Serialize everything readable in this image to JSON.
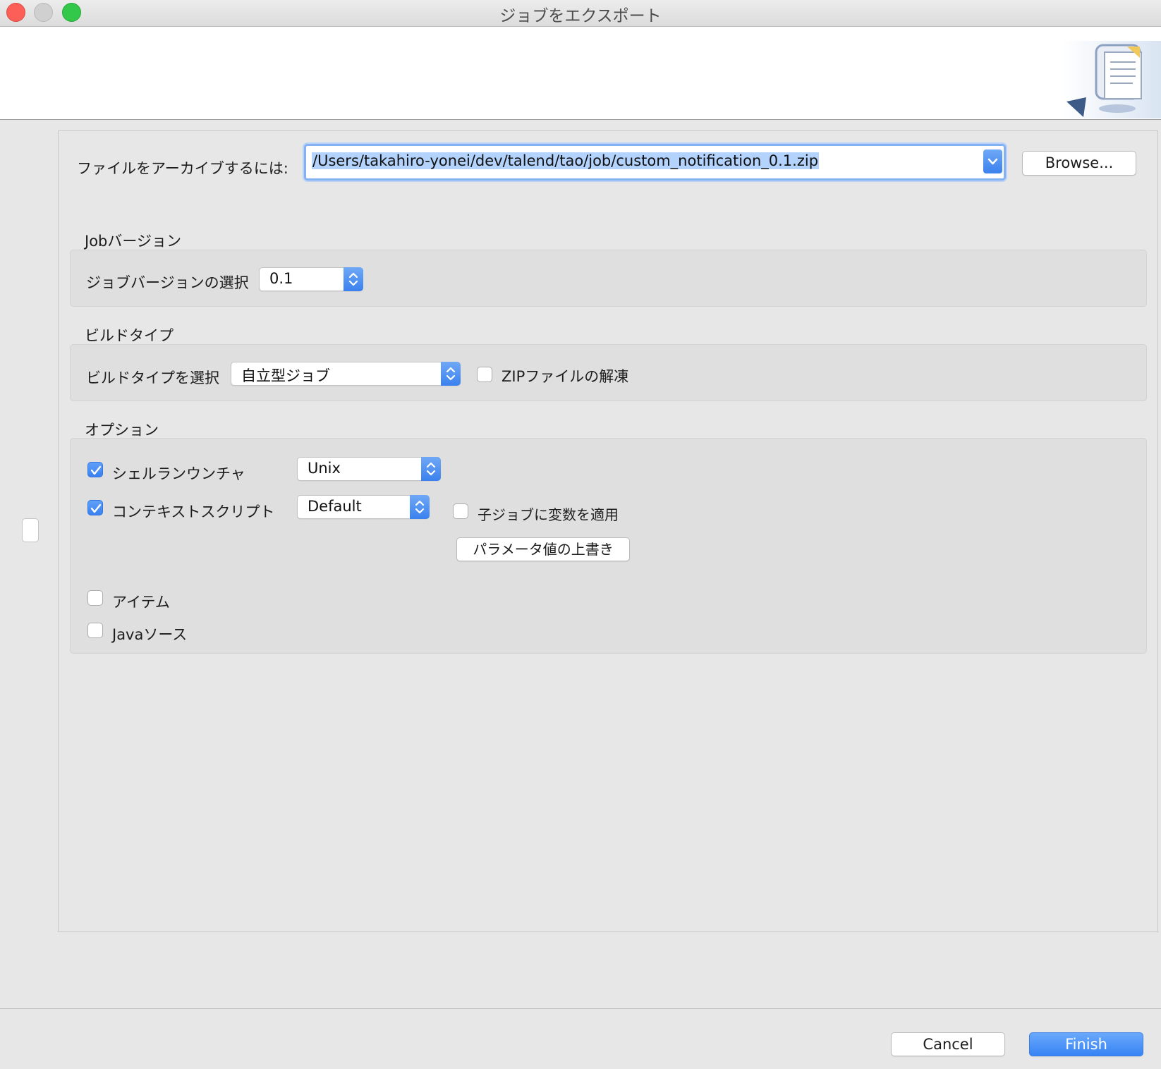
{
  "window": {
    "title": "ジョブをエクスポート"
  },
  "archive": {
    "label": "ファイルをアーカイブするには:",
    "path": "/Users/takahiro-yonei/dev/talend/tao/job/custom_notification_0.1.zip",
    "browse_label": "Browse..."
  },
  "job_version": {
    "group_title": "Jobバージョン",
    "label": "ジョブバージョンの選択",
    "selected": "0.1"
  },
  "build_type": {
    "group_title": "ビルドタイプ",
    "label": "ビルドタイプを選択",
    "selected": "自立型ジョブ",
    "unzip_label": "ZIPファイルの解凍",
    "unzip_checked": false
  },
  "options": {
    "group_title": "オプション",
    "shell_launcher": {
      "label": "シェルランウンチャ",
      "checked": true,
      "selected": "Unix"
    },
    "context_script": {
      "label": "コンテキストスクリプト",
      "checked": true,
      "selected": "Default"
    },
    "apply_child_label": "子ジョブに変数を適用",
    "apply_child_checked": false,
    "override_params_label": "パラメータ値の上書き",
    "items": {
      "label": "アイテム",
      "checked": false
    },
    "java_source": {
      "label": "Javaソース",
      "checked": false
    }
  },
  "footer": {
    "cancel_label": "Cancel",
    "finish_label": "Finish"
  },
  "colors": {
    "accent": "#3b81ee",
    "selection": "#b4d3fc"
  }
}
